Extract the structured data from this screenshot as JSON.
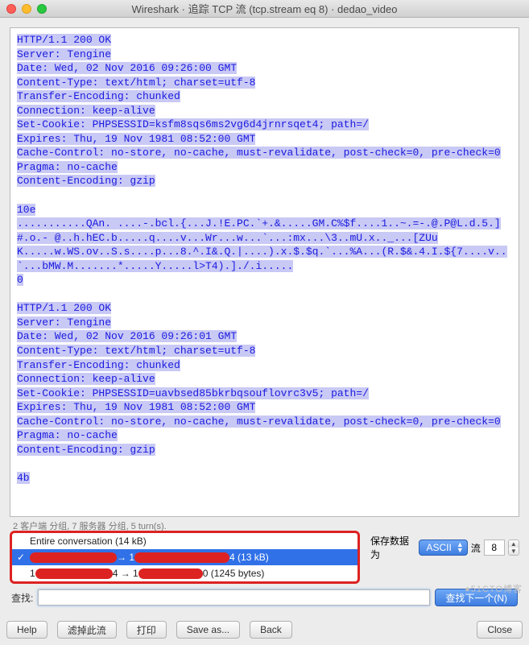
{
  "window": {
    "title": "Wireshark · 追踪 TCP 流 (tcp.stream eq 8) · dedao_video"
  },
  "stream_text": "HTTP/1.1 200 OK\nServer: Tengine\nDate: Wed, 02 Nov 2016 09:26:00 GMT\nContent-Type: text/html; charset=utf-8\nTransfer-Encoding: chunked\nConnection: keep-alive\nSet-Cookie: PHPSESSID=ksfm8sqs6ms2vg6d4jrnrsqet4; path=/\nExpires: Thu, 19 Nov 1981 08:52:00 GMT\nCache-Control: no-store, no-cache, must-revalidate, post-check=0, pre-check=0\nPragma: no-cache\nContent-Encoding: gzip\n\n10e\n...........QAn. ....-.bcl.{...J.!E.PC.`+.&.....GM.C%$f....1..~.=-.@.P@L.d.5.]#.o.- @..h.hEC.b.....q....v...Wr...w...`...:mx...\\3..mU.x.._...[ZUu\nK.....w.WS.ov..S.s....p...8.^.I&.Q.|....).x.$.$q.`...%A...(R.$&.4.I.${7....v..`...bMW.M.......*.....Y.....l>T4).]./.i.....\n0\n\nHTTP/1.1 200 OK\nServer: Tengine\nDate: Wed, 02 Nov 2016 09:26:01 GMT\nContent-Type: text/html; charset=utf-8\nTransfer-Encoding: chunked\nConnection: keep-alive\nSet-Cookie: PHPSESSID=uavbsed85bkrbqsouflovrc3v5; path=/\nExpires: Thu, 19 Nov 1981 08:52:00 GMT\nCache-Control: no-store, no-cache, must-revalidate, post-check=0, pre-check=0\nPragma: no-cache\nContent-Encoding: gzip\n\n4b",
  "muted_line": "2 客户端 分组, 7 服务器 分组, 5 turn(s).",
  "dropdown": {
    "item0": "Entire conversation (14 kB)",
    "item1_mid": " → 1",
    "item1_suffix": "4 (13 kB)",
    "item2_prefix": "1",
    "item2_mid": "4 → 1",
    "item2_suffix": "0 (1245 bytes)"
  },
  "right_controls": {
    "save_as_label": "保存数据为",
    "format_value": "ASCII",
    "stream_label": "流",
    "stream_value": "8"
  },
  "search": {
    "label": "查找:",
    "find_next": "查找下一个(N)"
  },
  "buttons": {
    "help": "Help",
    "filter_out": "滤掉此流",
    "print": "打印",
    "save_as": "Save as...",
    "back": "Back",
    "close": "Close"
  },
  "watermark": "●51CTO博客"
}
